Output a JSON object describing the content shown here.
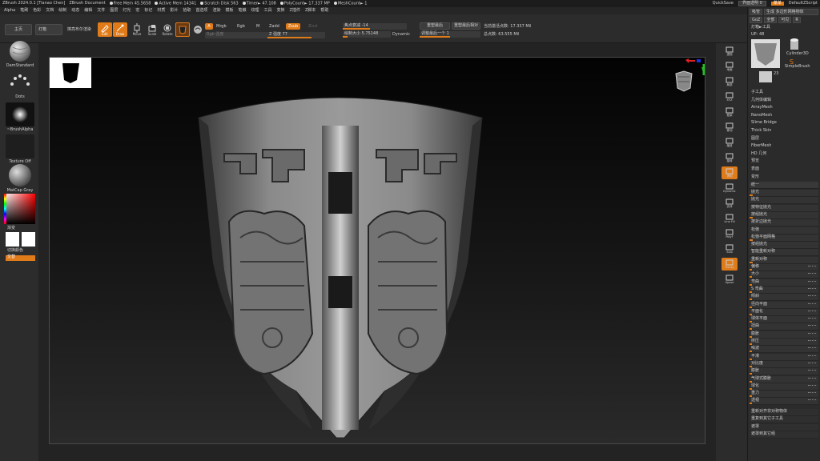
{
  "titlebar": {
    "app": "ZBrush 2024.0.1 [Tianao Chen]",
    "document": "ZBrush Document",
    "free_mem": "Free Mem 45.5658",
    "active_mem": "Active Mem 14341",
    "scratch": "Scratch Disk 563",
    "timer": "Timer► 47.108",
    "polycount": "PolyCount► 17.337 MP",
    "meshcount": "MeshCount► 1",
    "quicksave": "QuickSave",
    "transparency": "界面透明 0",
    "menu_btn": "菜单",
    "script": "DefaultZScript"
  },
  "menubar": {
    "items": [
      "Alpha",
      "笔刷",
      "色彩",
      "文档",
      "绘制",
      "动态",
      "编辑",
      "文件",
      "图层",
      "灯光",
      "宏",
      "标记",
      "材质",
      "影片",
      "拾取",
      "首选项",
      "渲染",
      "模板",
      "笔触",
      "纹理",
      "工具",
      "变换",
      "Z插件",
      "Z脚本",
      "帮助"
    ]
  },
  "toolbar": {
    "home": "主页",
    "lightbox": "灯箱",
    "spotlight": "擦亮布尔渲染",
    "btn_edit": "Edit",
    "btn_draw": "Draw",
    "btn_move": "Move",
    "btn_scale": "Scale",
    "btn_rotate": "Rotate",
    "a": "A",
    "mrgb": "Mrgb",
    "rgb": "Rgb",
    "m": "M",
    "zadd": "Zadd",
    "zsub": "Zsub",
    "zcut": "Zcut",
    "rgb_intensity": "Rgb 强度",
    "z_intensity": "Z 强度 77",
    "focal_shift": "焦点衰减 -14",
    "draw_size": "绘制大小 5.75148",
    "dynamic": "Dynamic",
    "sculpt_scale": "重塑最后",
    "sculpt_scale2": "重塑最后相对",
    "adjust": "调整最后一个 1",
    "active_points": "当前激活点数: 17.337 Mil",
    "total_points": "总点数: 63.555 Mil"
  },
  "leftshelf": {
    "brush": "DamStandard",
    "stroke": "Dots",
    "alpha": "~BrushAlpha",
    "texture": "Texture Off",
    "material": "MatCap Gray",
    "gradient": "渐变",
    "switch": "切换颜色",
    "alternate": "交替"
  },
  "rightshelf": {
    "items": [
      "透视",
      "地面",
      "局部",
      "XYZ",
      "框架",
      "移动",
      "缩放",
      "旋转",
      "透明",
      "Dynamic",
      "实体",
      "Line Fill",
      "PolyF",
      "Solo",
      "Transp",
      "Xpose"
    ]
  },
  "panel": {
    "header_btns": [
      "吸管",
      "生成 多边形网格物体"
    ],
    "row2": [
      "GoZ",
      "全部",
      "可见",
      "R"
    ],
    "lightbox_tools": "灯箱►工具",
    "up_label": "UP: 48",
    "cylinder": "Cylinder3D",
    "simplebrush": "SimpleBrush",
    "tool_count": "23",
    "subtool_list": [
      "子工具",
      "几何体编辑",
      "ArrayMesh",
      "NanoMesh",
      "Slime Bridge",
      "Thick Skin",
      "图层",
      "FiberMesh",
      "HD 几何",
      "预览",
      "表面",
      "变形"
    ],
    "deformation": {
      "header": "统一",
      "items": [
        "抛光",
        "抛光",
        "按特征抛光",
        "按组抛光",
        "按折边抛光",
        "松弛",
        "松弛平面网格",
        "按组抛光",
        "智能重新对称",
        "重新对称"
      ]
    },
    "deform_sliders": [
      "偏移",
      "大小",
      "弯曲",
      "S 弯曲",
      "倾斜",
      "径向平面",
      "平面化",
      "球体平面",
      "扭曲",
      "膨胀",
      "挤压",
      "噪波",
      "平滑",
      "对比度",
      "膨胀",
      "气球式膨胀",
      "球化",
      "重力",
      "透视"
    ],
    "footer": [
      "重新对齐非对称物体",
      "重复到其它子工具",
      "遮罩",
      "遮罩到其它组"
    ]
  },
  "colors": {
    "accent": "#e07b1a",
    "bg": "#2a2a2a",
    "canvas": "#0e0e0e"
  }
}
